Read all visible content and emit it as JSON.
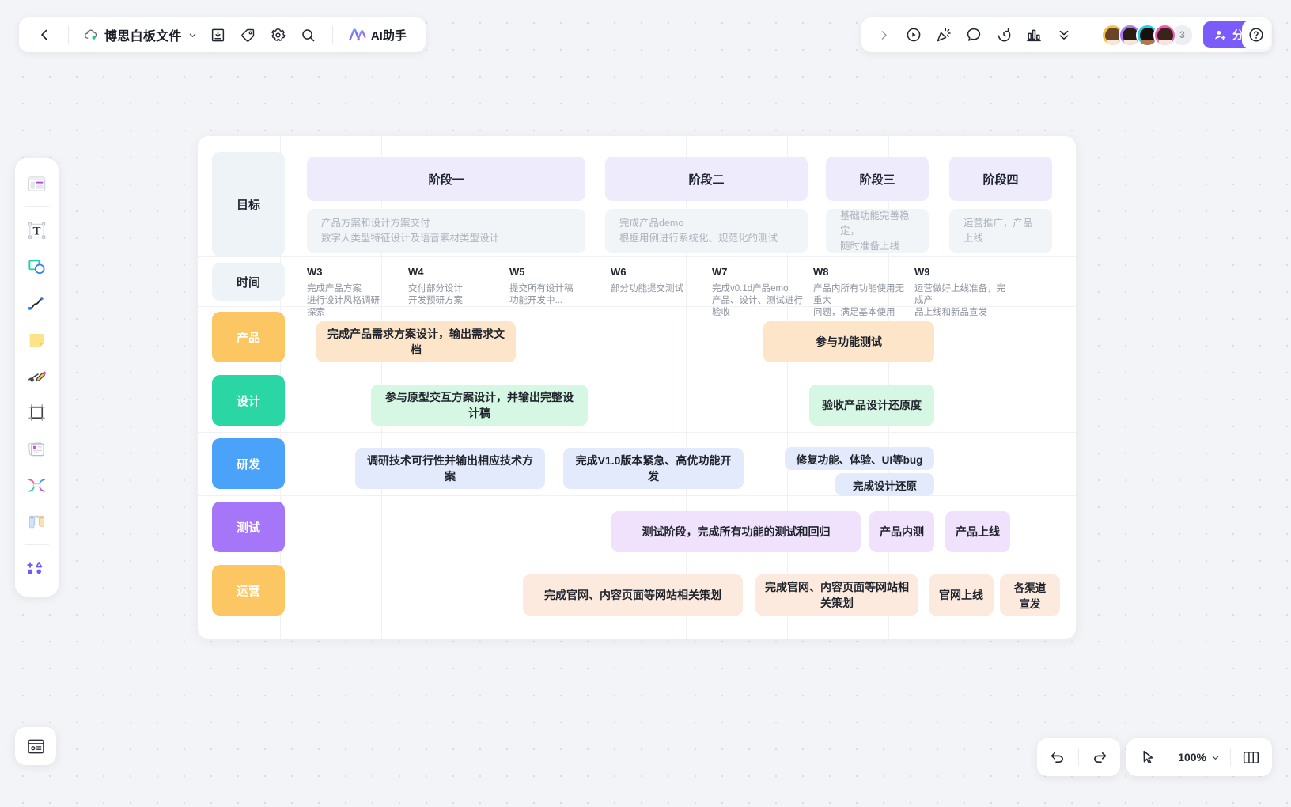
{
  "app": {
    "title": "博思白板文件",
    "ai_assistant_label": "AI助手",
    "share_label": "分享",
    "collaborator_overflow_count": "3",
    "zoom_level": "100%"
  },
  "topbar_left": {
    "back_icon": "back-chevron-icon",
    "cloud_icon": "cloud-sync-icon",
    "title_caret_icon": "chevron-down-icon",
    "download_icon": "download-icon",
    "tag_icon": "tag-icon",
    "settings_icon": "gear-icon",
    "search_icon": "search-icon",
    "ai_icon": "ai-sparkle-icon"
  },
  "topbar_right": {
    "expand_icon": "chevron-right-icon",
    "present_icon": "play-circle-icon",
    "celebrate_icon": "confetti-icon",
    "comment_icon": "comment-bubble-icon",
    "timer_icon": "timer-icon",
    "chart_icon": "bar-chart-icon",
    "more_icon": "double-chevron-down-icon",
    "share_icon": "add-person-icon",
    "help_icon": "question-mark-icon"
  },
  "left_toolbar": {
    "items": [
      {
        "name": "template-icon",
        "label": "模板"
      },
      {
        "name": "text-icon",
        "label": "文字"
      },
      {
        "name": "shape-icon",
        "label": "形状"
      },
      {
        "name": "connector-icon",
        "label": "连线"
      },
      {
        "name": "sticky-note-icon",
        "label": "便签"
      },
      {
        "name": "pen-icon",
        "label": "画笔"
      },
      {
        "name": "frame-icon",
        "label": "画框"
      },
      {
        "name": "card-icon",
        "label": "卡片"
      },
      {
        "name": "mindmap-icon",
        "label": "思维导图"
      },
      {
        "name": "kanban-icon",
        "label": "看板"
      },
      {
        "name": "more-shapes-icon",
        "label": "更多"
      }
    ]
  },
  "bottom_bar": {
    "undo_icon": "undo-arrow-icon",
    "redo_icon": "redo-arrow-icon",
    "pointer_icon": "cursor-pointer-icon",
    "zoom_caret_icon": "chevron-down-icon",
    "minimap_icon": "minimap-icon",
    "page_icon": "page-thumbnail-icon"
  },
  "board": {
    "row_labels": [
      {
        "text": "目标",
        "bg": "#eef3f8",
        "color": "#1f2430"
      },
      {
        "text": "时间",
        "bg": "#eef3f8",
        "color": "#1f2430"
      },
      {
        "text": "产品",
        "bg": "#fcc663",
        "color": "#ffffff"
      },
      {
        "text": "设计",
        "bg": "#2ad6a4",
        "color": "#ffffff"
      },
      {
        "text": "研发",
        "bg": "#4aa3f8",
        "color": "#ffffff"
      },
      {
        "text": "测试",
        "bg": "#a577f8",
        "color": "#ffffff"
      },
      {
        "text": "运营",
        "bg": "#fcc663",
        "color": "#ffffff"
      }
    ],
    "phases": [
      {
        "title": "阶段一",
        "desc": "产品方案和设计方案交付\n数字人类型特征设计及语音素材类型设计"
      },
      {
        "title": "阶段二",
        "desc": "完成产品demo\n根据用例进行系统化、规范化的测试"
      },
      {
        "title": "阶段三",
        "desc": "基础功能完善稳定，\n随时准备上线"
      },
      {
        "title": "阶段四",
        "desc": "运营推广，产品上线"
      }
    ],
    "weeks": [
      {
        "title": "W3",
        "desc": "完成产品方案\n进行设计风格调研探索"
      },
      {
        "title": "W4",
        "desc": "交付部分设计\n开发预研方案"
      },
      {
        "title": "W5",
        "desc": "提交所有设计稿\n功能开发中..."
      },
      {
        "title": "W6",
        "desc": "部分功能提交测试"
      },
      {
        "title": "W7",
        "desc": "完成v0.1d产品emo\n产品、设计、测试进行验收"
      },
      {
        "title": "W8",
        "desc": "产品内所有功能使用无重大\n问题，满足基本使用"
      },
      {
        "title": "W9",
        "desc": "运营做好上线准备，完成产\n品上线和新品宣发"
      }
    ],
    "tasks": [
      {
        "text": "完成产品需求方案设计，输出需求文档",
        "bg": "#fce5c8",
        "row": "产品"
      },
      {
        "text": "参与功能测试",
        "bg": "#fce5c8",
        "row": "产品"
      },
      {
        "text": "参与原型交互方案设计，并输出完整设计稿",
        "bg": "#d6f7e4",
        "row": "设计"
      },
      {
        "text": "验收产品设计还原度",
        "bg": "#d6f7e4",
        "row": "设计"
      },
      {
        "text": "调研技术可行性并输出相应技术方案",
        "bg": "#e3eafc",
        "row": "研发"
      },
      {
        "text": "完成V1.0版本紧急、高优功能开发",
        "bg": "#e3eafc",
        "row": "研发"
      },
      {
        "text": "修复功能、体验、UI等bug",
        "bg": "#e3eafc",
        "row": "研发"
      },
      {
        "text": "完成设计还原",
        "bg": "#e3eafc",
        "row": "研发"
      },
      {
        "text": "测试阶段，完成所有功能的测试和回归",
        "bg": "#f0e2fc",
        "row": "测试"
      },
      {
        "text": "产品内测",
        "bg": "#f0e2fc",
        "row": "测试"
      },
      {
        "text": "产品上线",
        "bg": "#f0e2fc",
        "row": "测试"
      },
      {
        "text": "完成官网、内容页面等网站相关策划",
        "bg": "#fdeade",
        "row": "运营"
      },
      {
        "text": "完成官网、内容页面等网站相关策划",
        "bg": "#fdeade",
        "row": "运营"
      },
      {
        "text": "官网上线",
        "bg": "#fdeade",
        "row": "运营"
      },
      {
        "text": "各渠道宣发",
        "bg": "#fdeade",
        "row": "运营"
      }
    ]
  },
  "colors": {
    "accent": "#7b5cfa",
    "canvas_bg": "#f2f4f7",
    "board_bg": "#ffffff"
  }
}
